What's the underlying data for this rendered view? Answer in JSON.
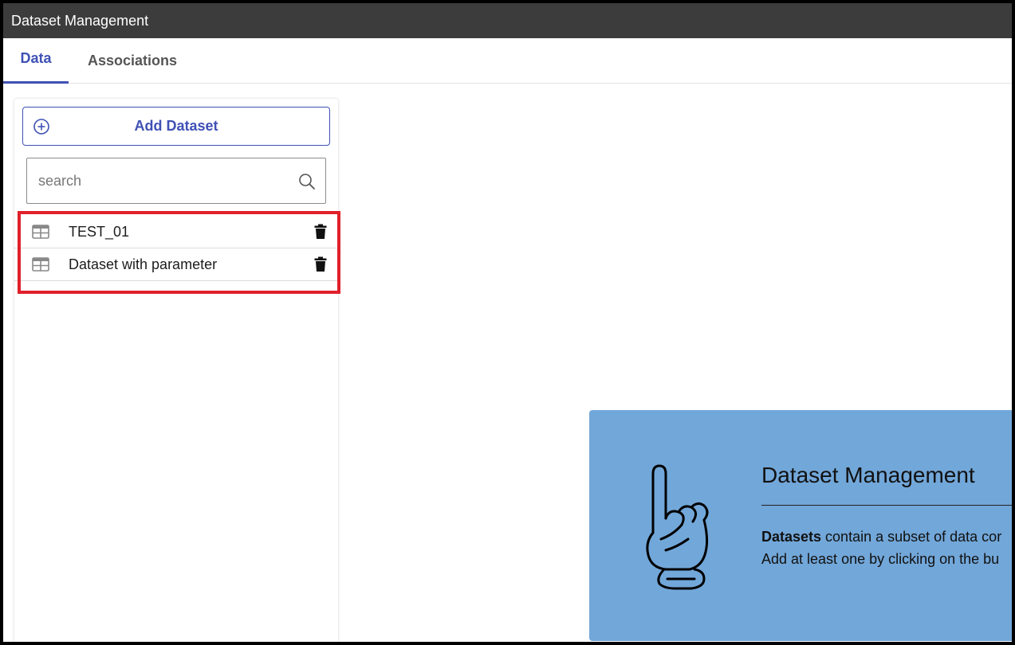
{
  "window": {
    "title": "Dataset Management"
  },
  "tabs": [
    {
      "label": "Data",
      "active": true
    },
    {
      "label": "Associations",
      "active": false
    }
  ],
  "sidebar": {
    "add_button_label": "Add Dataset",
    "add_icon": "plus-circle-icon",
    "search": {
      "placeholder": "search",
      "value": "",
      "icon": "search-icon"
    },
    "items": [
      {
        "label": "TEST_01",
        "icon": "table-icon",
        "action_icon": "trash-icon"
      },
      {
        "label": "Dataset with parameter",
        "icon": "table-icon",
        "action_icon": "trash-icon"
      }
    ]
  },
  "info_panel": {
    "title": "Dataset Management",
    "line1_bold": "Datasets",
    "line1_rest": " contain a subset of data cor",
    "line2": "Add at least one by clicking on the bu",
    "icon": "pointing-hand-icon"
  },
  "colors": {
    "titlebar_bg": "#3c3c3c",
    "accent": "#3f51b5",
    "highlight": "#e0202a",
    "panel_bg": "#72a7d9"
  }
}
